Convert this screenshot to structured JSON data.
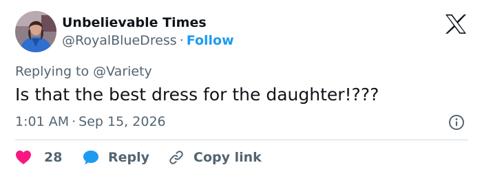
{
  "author": {
    "display_name": "Unbelievable Times",
    "handle": "@RoyalBlueDress",
    "separator": "·",
    "follow_label": "Follow"
  },
  "reply_context": {
    "prefix": "Replying to ",
    "mention": "@Variety"
  },
  "tweet": {
    "text": "Is that the best dress for the daughter!???",
    "time": "1:01 AM",
    "separator": "·",
    "date": "Sep 15, 2026"
  },
  "actions": {
    "like_count": "28",
    "reply_label": "Reply",
    "copy_link_label": "Copy link"
  },
  "icons": {
    "logo": "x-logo-icon",
    "info": "info-icon",
    "like": "heart-icon",
    "reply": "speech-bubble-icon",
    "copy": "link-icon"
  },
  "colors": {
    "accent": "#1d9bf0",
    "like": "#f91880",
    "text_primary": "#0f1419",
    "text_secondary": "#536471",
    "divider": "#cfd9de"
  }
}
